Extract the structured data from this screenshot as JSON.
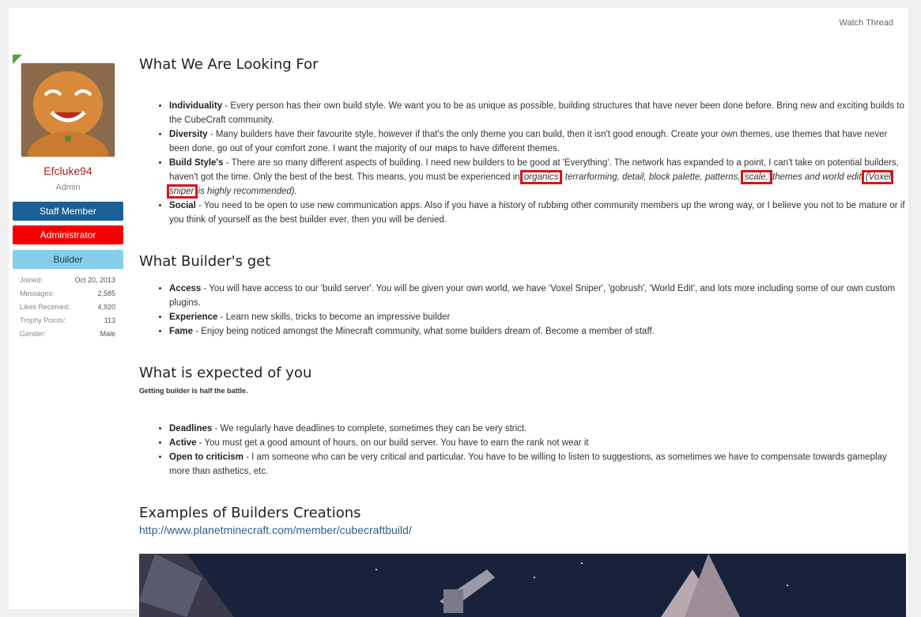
{
  "header": {
    "watch_thread": "Watch Thread"
  },
  "user": {
    "name": "Efcluke94",
    "title": "Admin",
    "banners": [
      "Staff Member",
      "Administrator",
      "Builder"
    ],
    "stats": [
      {
        "label": "Joined:",
        "value": "Oct 20, 2013"
      },
      {
        "label": "Messages:",
        "value": "2,585"
      },
      {
        "label": "Likes Received:",
        "value": "4,920"
      },
      {
        "label": "Trophy Points:",
        "value": "113"
      },
      {
        "label": "Gender:",
        "value": "Male"
      }
    ]
  },
  "sections": {
    "looking": {
      "heading": "What We Are Looking For",
      "items": [
        {
          "term": "Individuality",
          "text": " - Every person has their own build style. We want you to be as unique as possible, building structures that have never been done before. Bring new and exciting builds to the CubeCraft community."
        },
        {
          "term": "Diversity",
          "text": " - Many builders have their favourite style, however if that's the only theme you can build, then it isn't good enough. Create your own themes, use themes that have never been done, go out of your comfort zone. I want the majority of our maps to have different themes."
        },
        {
          "term": "Build Style's",
          "text_a": " - There are so many different aspects of building. I need new builders to be good at 'Everything'. The network has expanded to a point, I can't take on potential builders, haven't got the time. Only the best of the best. This means, you must be experienced in ",
          "hl1": "organics",
          "ital_a": ", terrarforming, detail, block palette, patterns, ",
          "hl2": "scale,",
          "ital_b": " themes and world edit ",
          "hl3": "(Voxel sniper",
          "ital_c": " is highly recommended)."
        },
        {
          "term": "Social",
          "text": " - You need to be open to use new communication apps. Also if you have a history of rubbing other community members up the wrong way, or I believe you not to be mature or if you think of yourself as the best builder ever, then you will be denied."
        }
      ]
    },
    "get": {
      "heading": "What Builder's get",
      "items": [
        {
          "term": "Access",
          "text": " - You will have access to our 'build server'. You will be given your own world, we have 'Voxel Sniper', 'gobrush', 'World Edit', and lots more including some of our own custom plugins."
        },
        {
          "term": "Experience",
          "text": " - Learn new skills, tricks to become an impressive builder"
        },
        {
          "term": "Fame",
          "text": " - Enjoy being noticed amongst the Minecraft community, what some builders dream of. Become a member of staff."
        }
      ]
    },
    "expected": {
      "heading": "What is expected of you",
      "note": "Getting builder is half the battle.",
      "items": [
        {
          "term": "Deadlines",
          "text": " - We regularly have deadlines to complete, sometimes they can be very strict."
        },
        {
          "term": "Active",
          "text": " - You must get a good amount of hours, on our build server. You have to earn the rank not wear it"
        },
        {
          "term": "Open to criticism",
          "text": " - I am someone who can be very critical and particular. You have to be willing to listen to suggestions, as sometimes we have to compensate towards gameplay more than asthetics, etc."
        }
      ]
    },
    "examples": {
      "heading": "Examples of Builders Creations",
      "link": "http://www.planetminecraft.com/member/cubecraftbuild/"
    }
  }
}
